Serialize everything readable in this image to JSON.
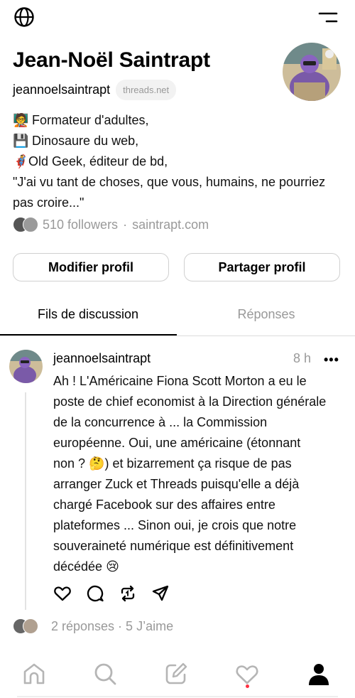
{
  "topbar": {
    "left_icon": "globe-icon",
    "right_icon": "menu-icon"
  },
  "profile": {
    "name": "Jean-Noël Saintrapt",
    "handle": "jeannoelsaintrapt",
    "domain_pill": "threads.net",
    "bio_lines": [
      {
        "emoji": "🧑‍🏫",
        "text": "Formateur d'adultes,"
      },
      {
        "emoji": "💾",
        "text": "Dinosaure du web,"
      },
      {
        "emoji": "🦸",
        "text": "Old Geek, éditeur de bd,"
      }
    ],
    "quote": "\"J'ai vu tant de choses, que vous, humains, ne pourriez pas croire...\"",
    "followers": "510 followers",
    "separator": "·",
    "website": "saintrapt.com"
  },
  "buttons": {
    "edit": "Modifier profil",
    "share": "Partager profil"
  },
  "tabs": {
    "threads": "Fils de discussion",
    "replies": "Réponses",
    "active": "threads"
  },
  "post": {
    "username": "jeannoelsaintrapt",
    "time": "8 h",
    "more": "•••",
    "lines": [
      "Ah ! L'Américaine Fiona Scott Morton a eu le",
      "poste de chief economist à la Direction générale",
      "de la concurrence à ... la Commission",
      "européenne. Oui, une américaine (étonnant",
      "non ? 🤔) et bizarrement ça risque de pas",
      "arranger Zuck et Threads puisqu'elle a déjà",
      "chargé Facebook sur des affaires entre",
      "plateformes ... Sinon oui, je crois que notre",
      "souveraineté numérique est définitivement",
      "décédée 😢"
    ],
    "stats": "2 réponses · 5 J’aime",
    "actions": [
      "heart-icon",
      "comment-icon",
      "repost-icon",
      "share-icon"
    ]
  },
  "bottom_nav": [
    "home-icon",
    "search-icon",
    "compose-icon",
    "activity-icon",
    "profile-icon"
  ],
  "colors": {
    "muted": "#999999",
    "divider": "#dcdcdc",
    "pill_bg": "#f2f2f2",
    "notif": "#ff3040",
    "avatar_purple": "#7a5aa8"
  }
}
